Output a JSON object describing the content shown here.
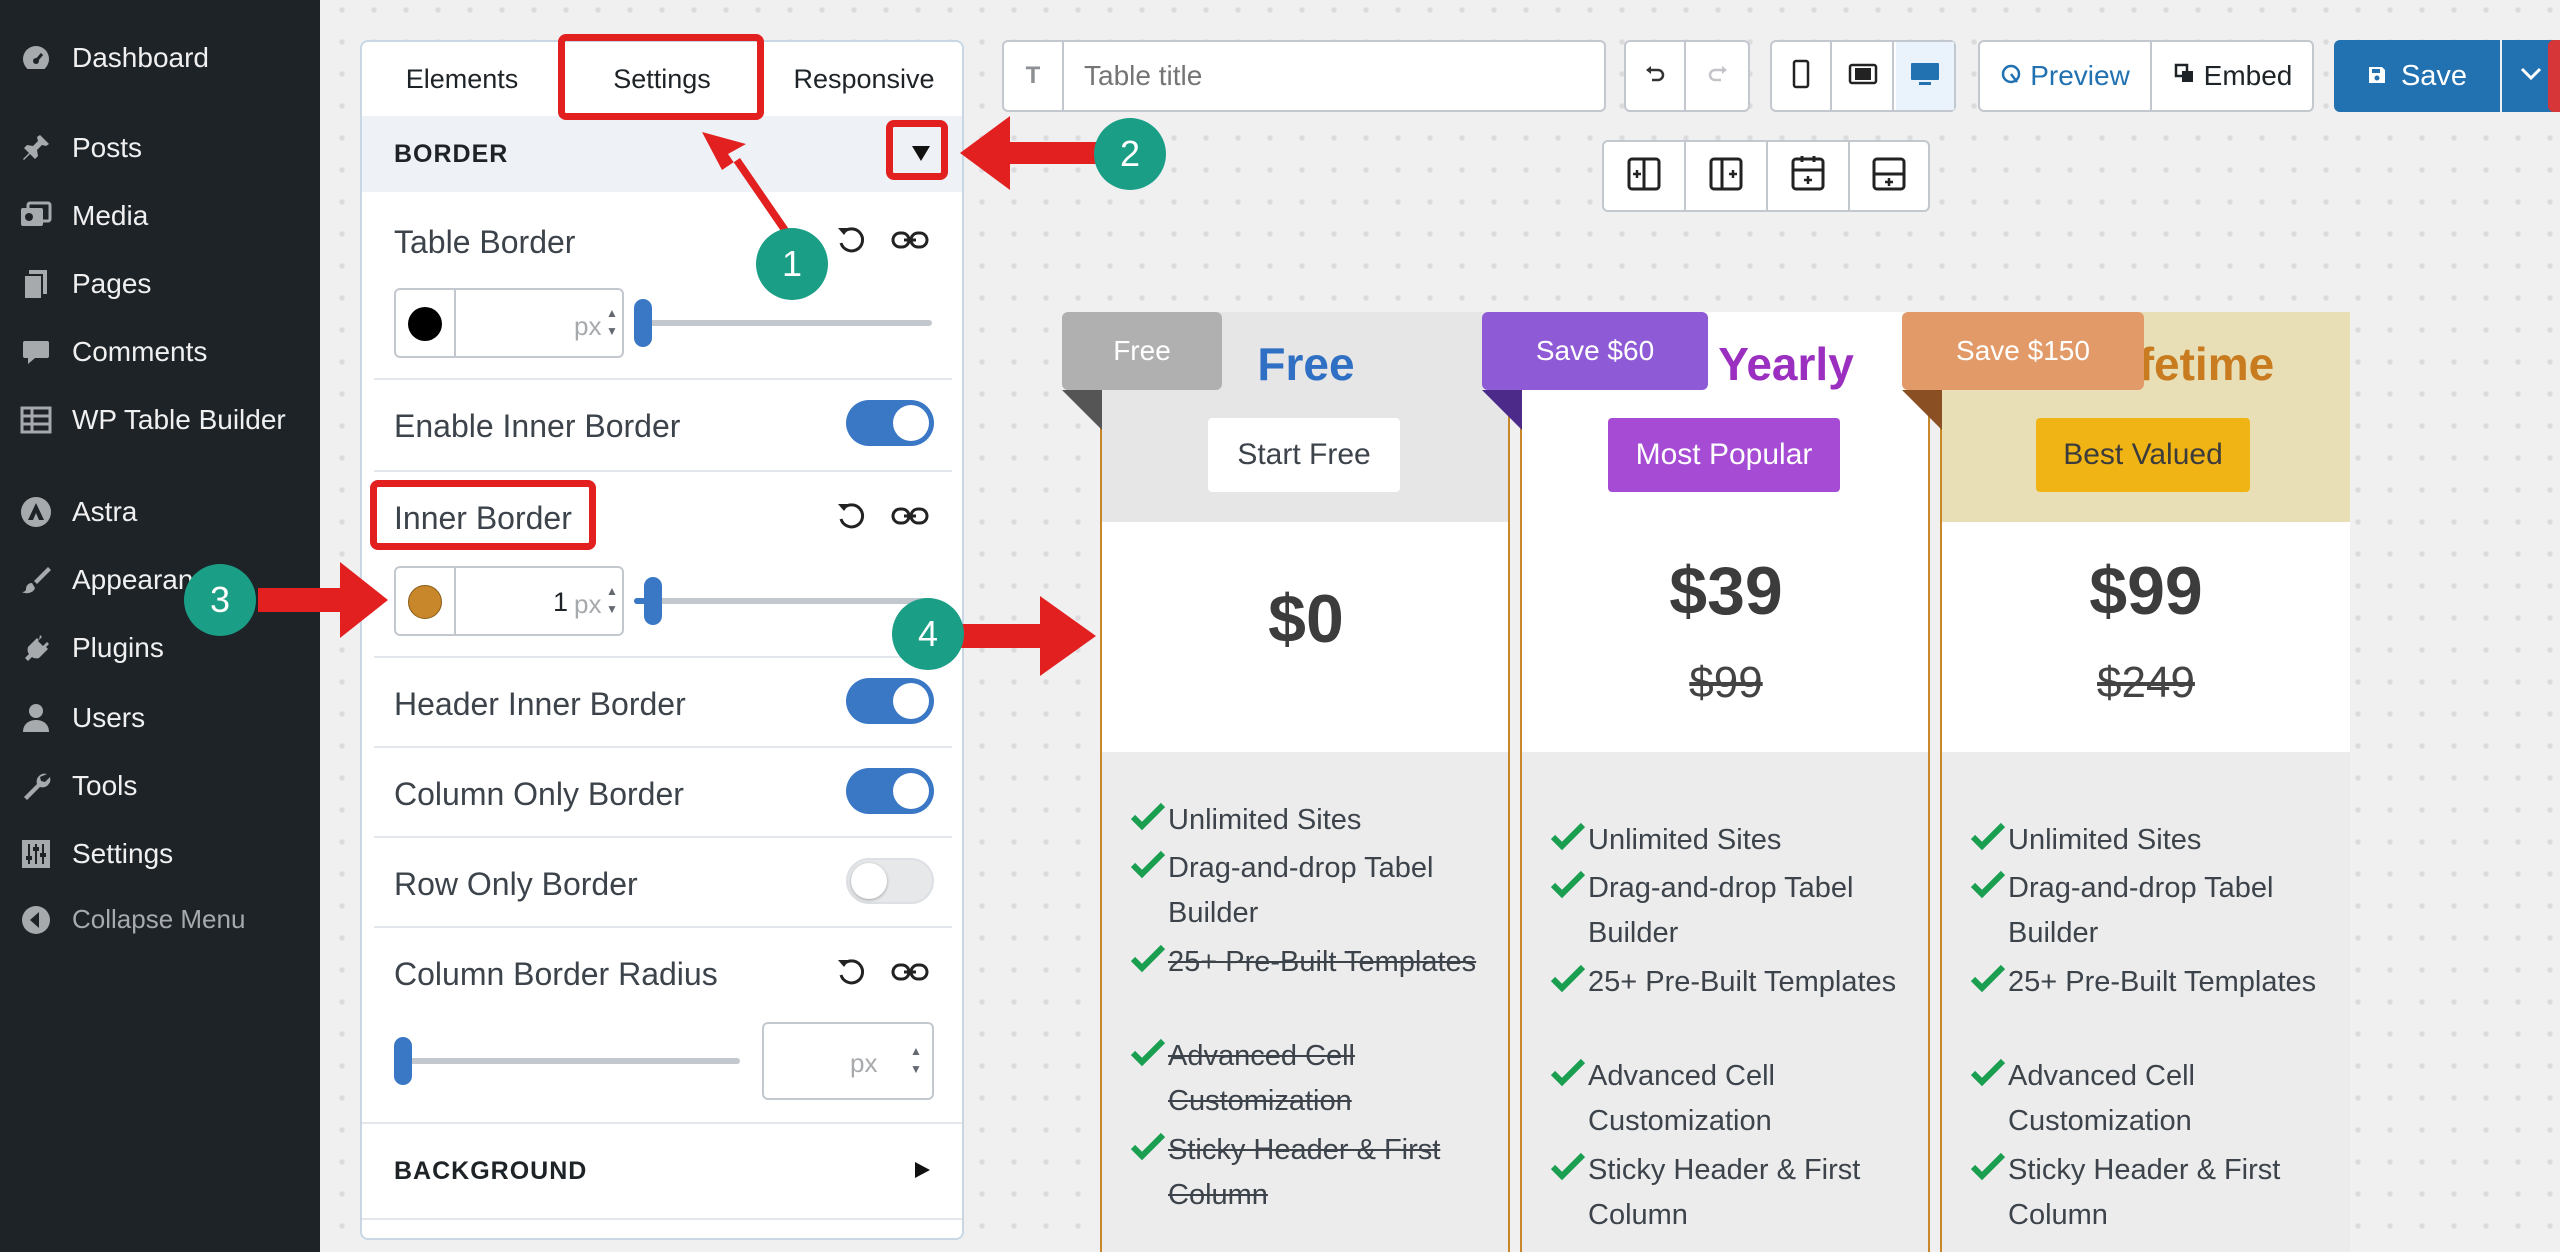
{
  "sidebar": {
    "items": [
      {
        "label": "Dashboard",
        "icon": "dashboard-icon"
      },
      {
        "label": "Posts",
        "icon": "pin-icon"
      },
      {
        "label": "Media",
        "icon": "media-icon"
      },
      {
        "label": "Pages",
        "icon": "pages-icon"
      },
      {
        "label": "Comments",
        "icon": "comments-icon"
      },
      {
        "label": "WP Table Builder",
        "icon": "table-icon"
      },
      {
        "label": "Astra",
        "icon": "astra-icon"
      },
      {
        "label": "Appearance",
        "icon": "brush-icon"
      },
      {
        "label": "Plugins",
        "icon": "plugin-icon"
      },
      {
        "label": "Users",
        "icon": "user-icon"
      },
      {
        "label": "Tools",
        "icon": "wrench-icon"
      },
      {
        "label": "Settings",
        "icon": "sliders-icon"
      },
      {
        "label": "Collapse Menu",
        "icon": "collapse-icon"
      }
    ]
  },
  "panel": {
    "tabs": [
      "Elements",
      "Settings",
      "Responsive"
    ],
    "active_tab": "Settings",
    "border_section": {
      "title": "BORDER",
      "expanded": true,
      "table_border": {
        "label": "Table Border",
        "value": "",
        "unit": "px",
        "color": "#000000",
        "slider": 0
      },
      "enable_inner_border": {
        "label": "Enable Inner Border",
        "on": true
      },
      "inner_border": {
        "label": "Inner Border",
        "value": "1",
        "unit": "px",
        "color": "#c7872a",
        "slider": 0.04
      },
      "header_inner_border": {
        "label": "Header Inner Border",
        "on": true
      },
      "column_only_border": {
        "label": "Column Only Border",
        "on": true
      },
      "row_only_border": {
        "label": "Row Only Border",
        "on": false
      },
      "column_border_radius": {
        "label": "Column Border Radius",
        "value": "",
        "unit": "px",
        "slider": 0
      }
    },
    "background_section": {
      "title": "BACKGROUND",
      "expanded": false
    }
  },
  "toolbar": {
    "title_placeholder": "Table title",
    "title_icon": "T",
    "preview_label": "Preview",
    "embed_label": "Embed",
    "save_label": "Save",
    "accent": "#2271b1"
  },
  "table": {
    "border_color": "#c7872a",
    "plans": [
      {
        "badge": "Free",
        "badge_color": "#b0b0b0",
        "name": "Free",
        "name_color": "#2f6fc4",
        "button": "Start Free",
        "button_bg": "#ffffff",
        "button_color": "#3c434a",
        "head_bg": "#e6e6e6",
        "price": "$0",
        "old_price": "",
        "features": [
          {
            "text": "Unlimited Sites",
            "included": true
          },
          {
            "text": "Drag-and-drop Tabel Builder",
            "included": true
          },
          {
            "text": "25+ Pre-Built Templates",
            "included": false
          },
          {
            "text": "Advanced Cell Customization",
            "included": false
          },
          {
            "text": "Sticky Header & First Column",
            "included": false
          }
        ]
      },
      {
        "badge": "Save $60",
        "badge_color": "#8e5ad6",
        "name": "Yearly",
        "name_color": "#9a2fc0",
        "button": "Most Popular",
        "button_bg": "#a54bd4",
        "button_color": "#ffffff",
        "head_bg": "#ffffff",
        "price": "$39",
        "old_price": "$99",
        "features": [
          {
            "text": "Unlimited Sites",
            "included": true
          },
          {
            "text": "Drag-and-drop Tabel Builder",
            "included": true
          },
          {
            "text": "25+ Pre-Built Templates",
            "included": true
          },
          {
            "text": "Advanced Cell Customization",
            "included": true
          },
          {
            "text": "Sticky Header & First Column",
            "included": true
          }
        ]
      },
      {
        "badge": "Save $150",
        "badge_color": "#e29a68",
        "name": "Lifetime",
        "name_color": "#c97b1f",
        "button": "Best Valued",
        "button_bg": "#f1b415",
        "button_color": "#3c3c3c",
        "head_bg": "#e8dfb6",
        "price": "$99",
        "old_price": "$249",
        "features": [
          {
            "text": "Unlimited Sites",
            "included": true
          },
          {
            "text": "Drag-and-drop Tabel Builder",
            "included": true
          },
          {
            "text": "25+ Pre-Built Templates",
            "included": true
          },
          {
            "text": "Advanced Cell Customization",
            "included": true
          },
          {
            "text": "Sticky Header & First Column",
            "included": true
          }
        ]
      }
    ]
  },
  "annotations": [
    "1",
    "2",
    "3",
    "4"
  ]
}
